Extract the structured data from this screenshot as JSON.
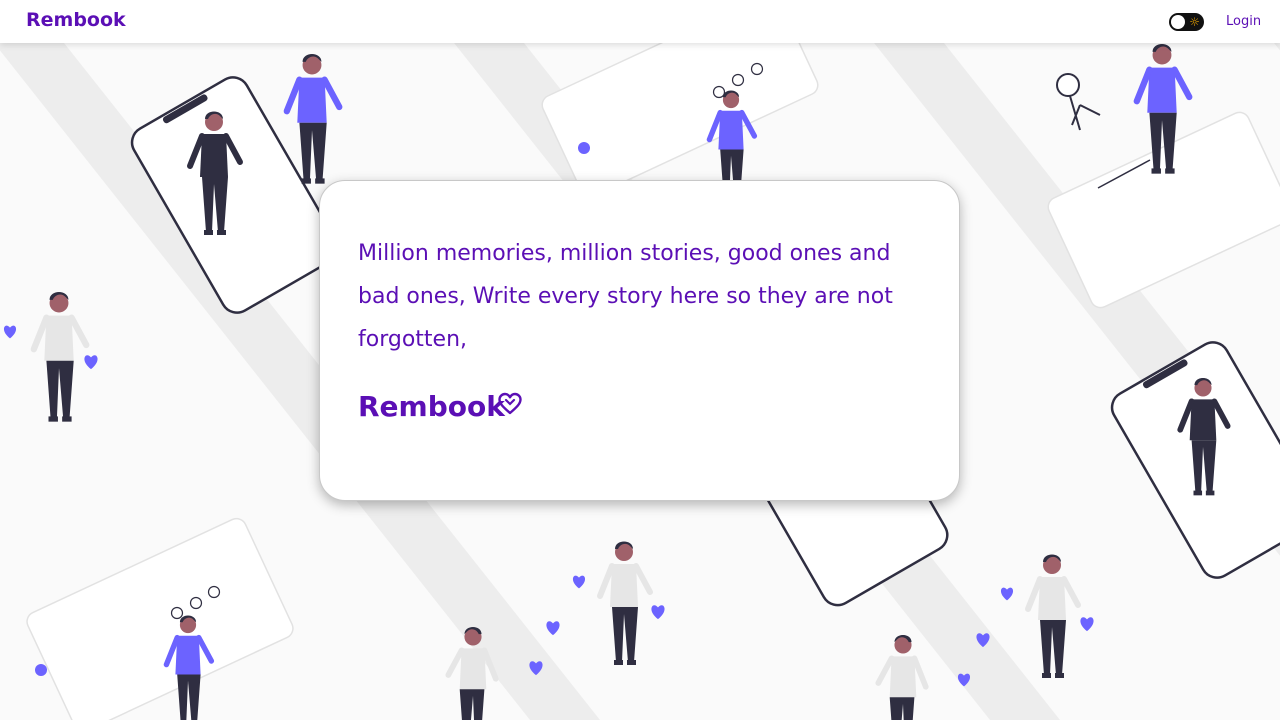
{
  "header": {
    "brand": "Rembook",
    "theme_toggle_icon": "sun-icon",
    "login_label": "Login"
  },
  "hero": {
    "tagline": "Million memories, million stories, good ones and bad ones, Write every story here so they are not forgotten,",
    "brand": "Rembook",
    "brand_icon": "heart-icon"
  },
  "colors": {
    "brand": "#5b0fb5",
    "accent": "#6c63ff",
    "dark": "#2f2e41",
    "stripe": "#ededed",
    "toggle_bg": "#111111",
    "sun": "#f2a900"
  }
}
